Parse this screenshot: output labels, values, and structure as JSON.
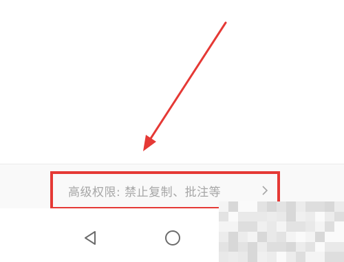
{
  "permission_setting": {
    "label": "高级权限: 禁止复制、批注等",
    "chevron_icon": "chevron-right-icon"
  },
  "annotation": {
    "color": "#e53935"
  },
  "navigation_bar": {
    "back_icon": "triangle-back-icon",
    "home_icon": "circle-home-icon"
  }
}
